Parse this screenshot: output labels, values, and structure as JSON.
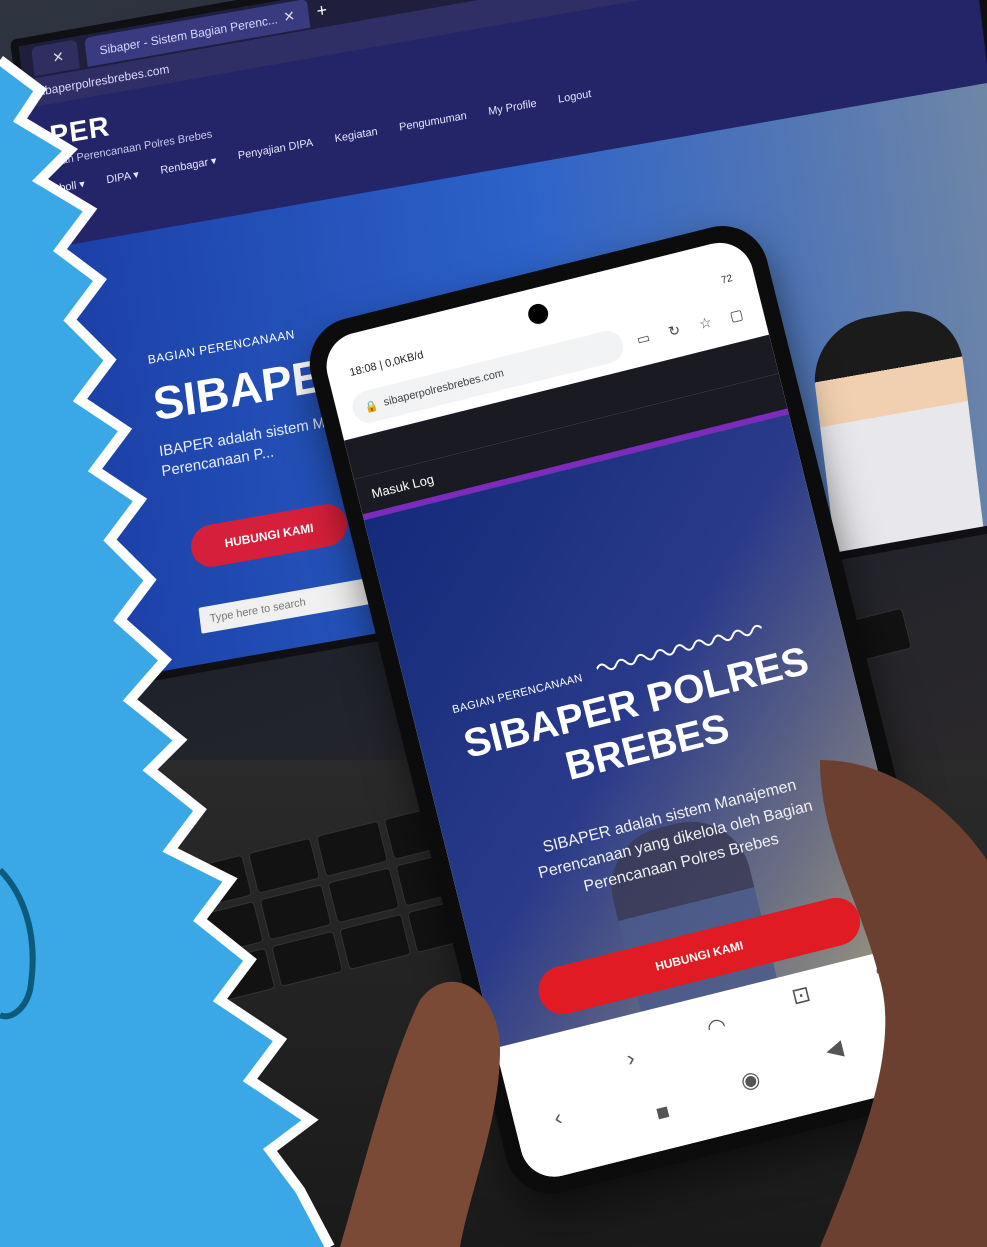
{
  "laptop": {
    "tab_label": "Sibaper - Sistem Bagian Perenc...",
    "url": "sibaperpolresbrebes.com",
    "site_logo": "PER",
    "site_subtitle": "gian Perencanaan Polres Brebes",
    "nav": [
      "tboll ▾",
      "DIPA ▾",
      "Renbagar ▾",
      "Penyajian DIPA",
      "Kegiatan",
      "Pengumuman",
      "My Profile",
      "Logout"
    ],
    "hero_eyebrow": "BAGIAN PERENCANAAN",
    "hero_title": "SIBAPER PO",
    "hero_desc": "IBAPER adalah sistem M... h Bagian Perencanaan P...",
    "hero_button": "HUBUNGI KAMI",
    "taskbar_search": "Type here to search"
  },
  "phone": {
    "status_time": "18:08 | 0,0KB/d",
    "status_right": "72",
    "url": "sibaperpolresbrebes.com",
    "login_link": "Masuk Log",
    "eyebrow": "BAGIAN PERENCANAAN",
    "title": "SIBAPER POLRES BREBES",
    "description": "SIBAPER adalah sistem Manajemen Perencanaan yang dikelola oleh Bagian Perencanaan Polres Brebes",
    "button": "HUBUNGI KAMI"
  },
  "colors": {
    "paper_blue": "#3aa7e6",
    "brand_red": "#e01b24",
    "accent_purple": "#7c2bbd"
  },
  "icons": [
    "book-icon",
    "refresh-icon",
    "star-icon",
    "tabs-icon",
    "lock-icon",
    "back-icon",
    "home-icon",
    "recent-icon",
    "chat-icon",
    "game-icon",
    "profile-icon"
  ]
}
